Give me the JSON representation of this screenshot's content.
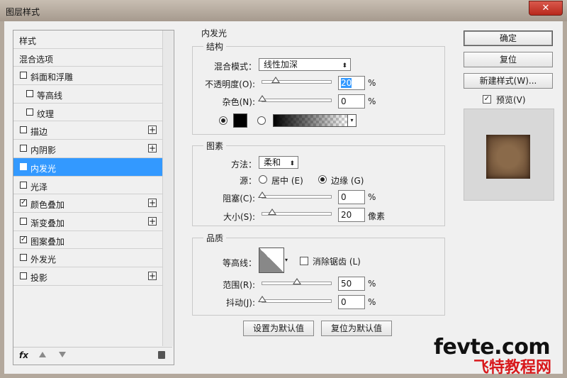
{
  "window": {
    "title": "图层样式",
    "close": "✕"
  },
  "sidebar": {
    "items": [
      {
        "label": "样式",
        "checkbox": false,
        "checked": false,
        "plus": false
      },
      {
        "label": "混合选项",
        "checkbox": false,
        "checked": false,
        "plus": false
      },
      {
        "label": "斜面和浮雕",
        "checkbox": true,
        "checked": false,
        "plus": false
      },
      {
        "label": "等高线",
        "checkbox": true,
        "checked": false,
        "plus": false,
        "indent": true
      },
      {
        "label": "纹理",
        "checkbox": true,
        "checked": false,
        "plus": false,
        "indent": true
      },
      {
        "label": "描边",
        "checkbox": true,
        "checked": false,
        "plus": true
      },
      {
        "label": "内阴影",
        "checkbox": true,
        "checked": false,
        "plus": true
      },
      {
        "label": "内发光",
        "checkbox": true,
        "checked": true,
        "plus": false,
        "selected": true
      },
      {
        "label": "光泽",
        "checkbox": true,
        "checked": false,
        "plus": false
      },
      {
        "label": "颜色叠加",
        "checkbox": true,
        "checked": true,
        "plus": true
      },
      {
        "label": "渐变叠加",
        "checkbox": true,
        "checked": false,
        "plus": true
      },
      {
        "label": "图案叠加",
        "checkbox": true,
        "checked": true,
        "plus": false
      },
      {
        "label": "外发光",
        "checkbox": true,
        "checked": false,
        "plus": false
      },
      {
        "label": "投影",
        "checkbox": true,
        "checked": false,
        "plus": true
      }
    ],
    "plus_glyph": "+",
    "check_glyph": "✓",
    "footer": {
      "fx": "fx",
      "fx_icon": "fx-icon",
      "up_icon": "move-up-icon",
      "down_icon": "move-down-icon",
      "trash_icon": "trash-icon"
    }
  },
  "panel": {
    "title": "内发光",
    "structure": {
      "title": "结构",
      "blend_mode_label": "混合模式：",
      "blend_mode_value": "线性加深",
      "opacity_label": "不透明度(O):",
      "opacity_value": "20",
      "opacity_level": 20,
      "noise_label": "杂色(N):",
      "noise_value": "0",
      "noise_level": 0,
      "percent": "%",
      "color": "#000000",
      "color_selected": true
    },
    "elements": {
      "title": "图素",
      "method_label": "方法：",
      "method_value": "柔和",
      "source_label": "源：",
      "source_center": "居中 (E)",
      "source_edge": "边缘 (G)",
      "source_selected": "edge",
      "choke_label": "阻塞(C):",
      "choke_value": "0",
      "choke_level": 0,
      "size_label": "大小(S):",
      "size_value": "20",
      "size_unit": "像素",
      "percent": "%"
    },
    "quality": {
      "title": "品质",
      "contour_label": "等高线：",
      "antialias_label": "消除锯齿 (L)",
      "antialias_checked": false,
      "range_label": "范围(R):",
      "range_value": "50",
      "range_level": 50,
      "jitter_label": "抖动(J):",
      "jitter_value": "0",
      "jitter_level": 0,
      "percent": "%"
    },
    "set_default": "设置为默认值",
    "reset_default": "复位为默认值"
  },
  "buttons": {
    "ok": "确定",
    "reset": "复位",
    "new_style": "新建样式(W)...",
    "preview_label": "预览(V)",
    "preview_checked": true
  },
  "watermark": {
    "line1": "fevte.com",
    "line2": "飞特教程网"
  },
  "colors": {
    "selection": "#3399ff",
    "watermark_red": "#d8191c"
  }
}
